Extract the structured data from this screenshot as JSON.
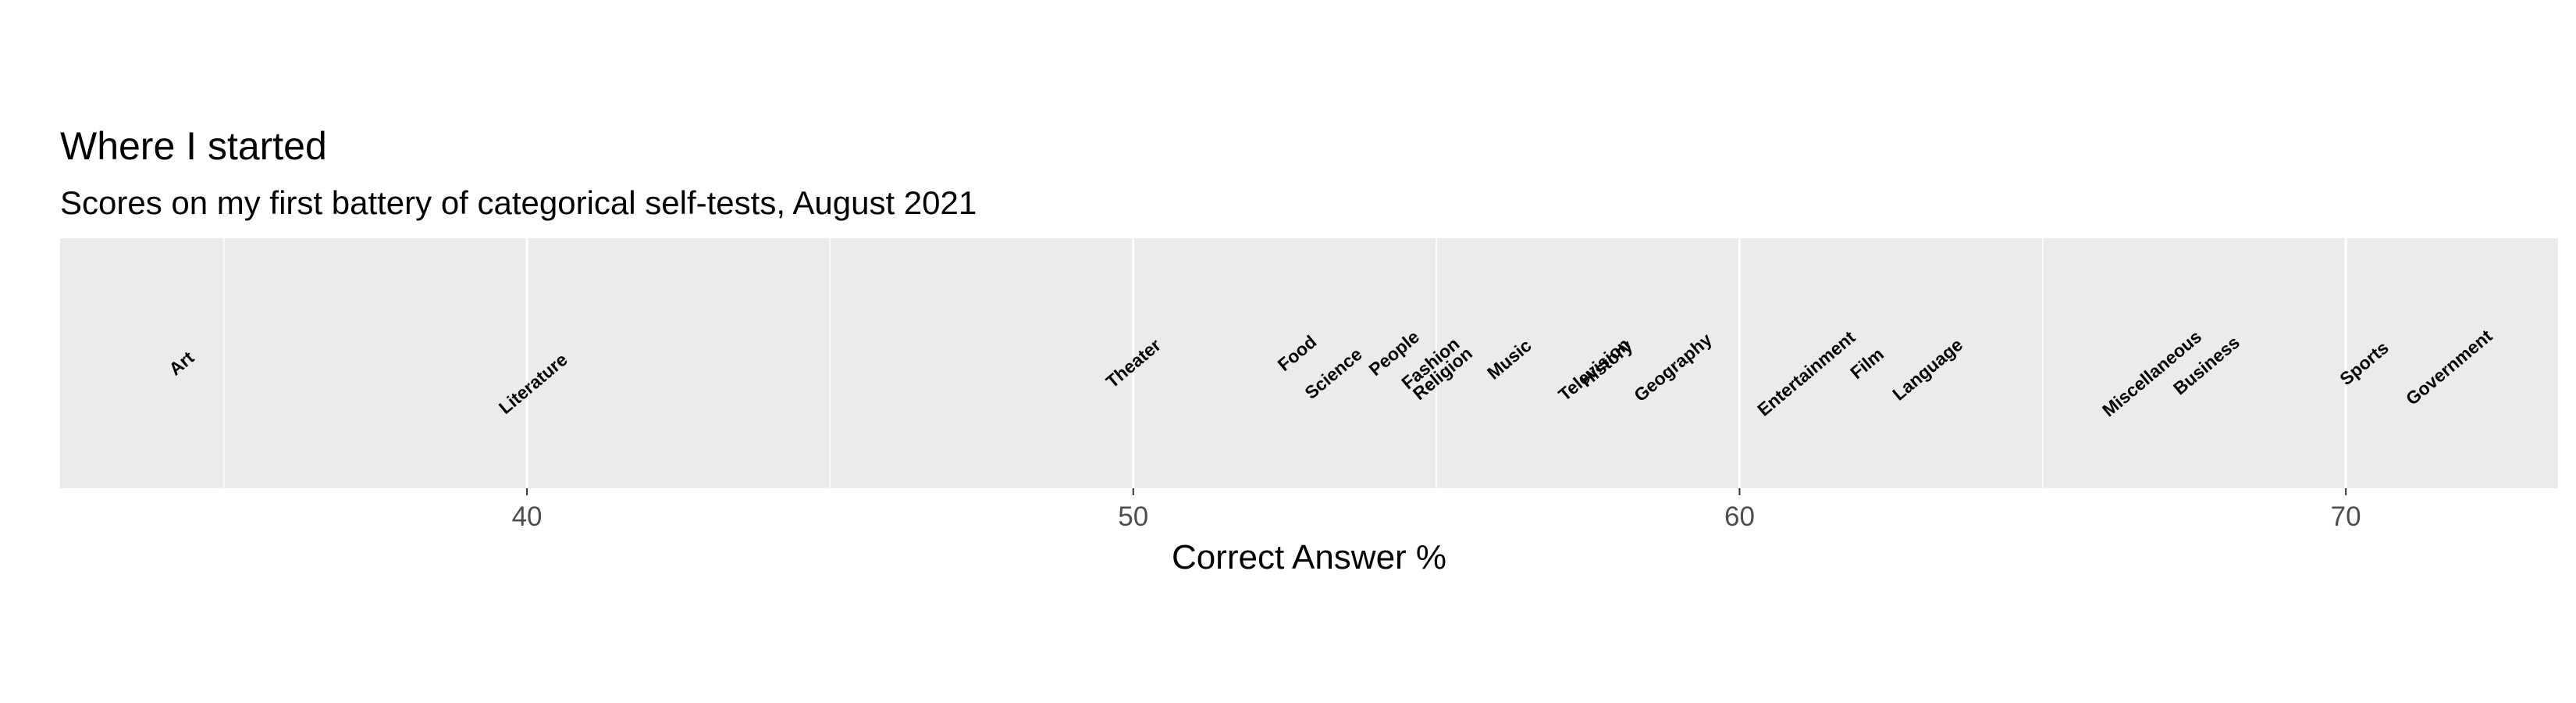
{
  "chart_data": {
    "type": "scatter",
    "title": "Where I started",
    "subtitle": "Scores on my first battery of categorical self-tests, August 2021",
    "xlabel": "Correct Answer %",
    "ylabel": "",
    "xlim": [
      32.3,
      73.5
    ],
    "x_ticks": [
      40,
      50,
      60,
      70
    ],
    "x_minor_ticks": [
      35,
      45,
      55,
      65
    ],
    "x_tick_labels": [
      "40",
      "50",
      "60",
      "70"
    ],
    "grid": true,
    "panel_background": "#ebebeb",
    "grid_color": "#ffffff",
    "label_rotation_deg": -40,
    "points": [
      {
        "label": "Art",
        "x": 34.3,
        "y": 0.0
      },
      {
        "label": "Literature",
        "x": 40.1,
        "y": -0.1
      },
      {
        "label": "Theater",
        "x": 50.0,
        "y": 0.0
      },
      {
        "label": "Food",
        "x": 52.7,
        "y": 0.05
      },
      {
        "label": "Science",
        "x": 53.3,
        "y": -0.05
      },
      {
        "label": "People",
        "x": 54.3,
        "y": 0.05
      },
      {
        "label": "Fashion",
        "x": 54.9,
        "y": 0.0
      },
      {
        "label": "Religion",
        "x": 55.1,
        "y": -0.05
      },
      {
        "label": "Music",
        "x": 56.2,
        "y": 0.02
      },
      {
        "label": "Television",
        "x": 57.6,
        "y": -0.03
      },
      {
        "label": "History",
        "x": 57.8,
        "y": 0.0
      },
      {
        "label": "Geography",
        "x": 58.9,
        "y": -0.02
      },
      {
        "label": "Entertainment",
        "x": 61.1,
        "y": -0.05
      },
      {
        "label": "Film",
        "x": 62.1,
        "y": 0.0
      },
      {
        "label": "Language",
        "x": 63.1,
        "y": -0.03
      },
      {
        "label": "Miscellaneous",
        "x": 66.8,
        "y": -0.05
      },
      {
        "label": "Business",
        "x": 67.7,
        "y": -0.01
      },
      {
        "label": "Sports",
        "x": 70.3,
        "y": 0.0
      },
      {
        "label": "Government",
        "x": 71.7,
        "y": -0.02
      }
    ]
  }
}
